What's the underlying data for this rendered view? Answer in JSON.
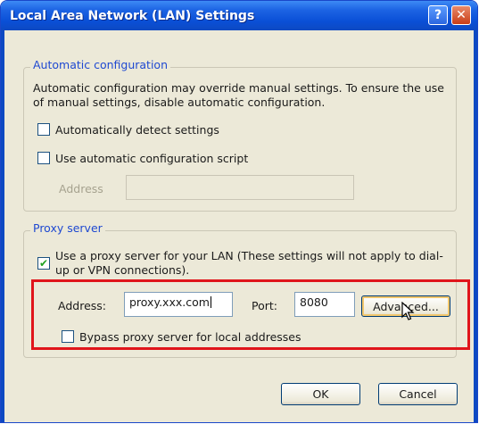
{
  "window": {
    "title": "Local Area Network (LAN) Settings",
    "help_glyph": "?",
    "close_glyph": "✕"
  },
  "auto_config": {
    "legend": "Automatic configuration",
    "description": "Automatic configuration may override manual settings.  To ensure the use of manual settings, disable automatic configuration.",
    "detect_label": "Automatically detect settings",
    "detect_checked": false,
    "script_label": "Use automatic configuration script",
    "script_checked": false,
    "address_label": "Address",
    "address_value": ""
  },
  "proxy": {
    "legend": "Proxy server",
    "use_proxy_label": "Use a proxy server for your LAN (These settings will not apply to dial-up or VPN connections).",
    "use_proxy_checked": true,
    "address_label": "Address:",
    "address_value": "proxy.xxx.com",
    "port_label": "Port:",
    "port_value": "8080",
    "advanced_label": "Advanced...",
    "bypass_label": "Bypass proxy server for local addresses",
    "bypass_checked": false
  },
  "buttons": {
    "ok": "OK",
    "cancel": "Cancel"
  },
  "colors": {
    "title_bar": "#0a4fd6",
    "group_legend": "#1f49d1",
    "highlight_box": "#e0151b",
    "dialog_bg": "#ece9d8"
  }
}
